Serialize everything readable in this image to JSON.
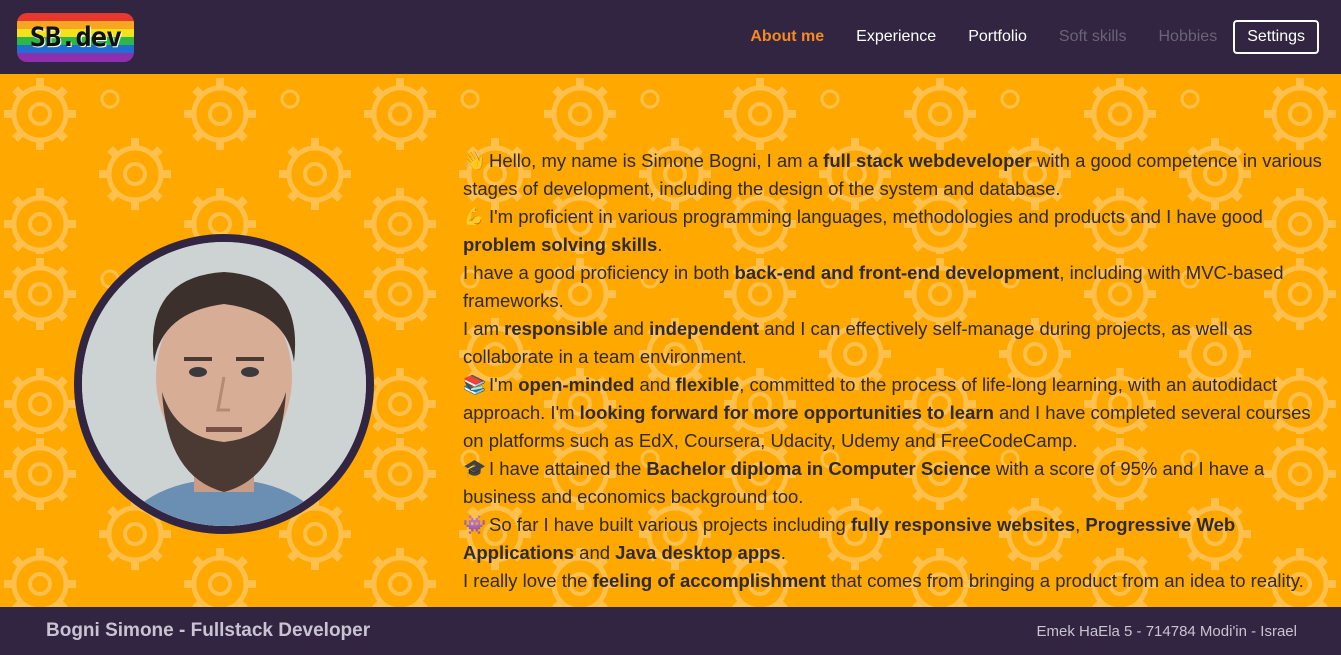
{
  "brand": {
    "logo_text": "SB.dev",
    "rainbow": [
      "#e8372d",
      "#f5a623",
      "#f5e11b",
      "#2db64a",
      "#1f6fd1",
      "#8e2fb0"
    ]
  },
  "nav": {
    "items": [
      {
        "label": "About me",
        "state": "active"
      },
      {
        "label": "Experience",
        "state": "normal"
      },
      {
        "label": "Portfolio",
        "state": "normal"
      },
      {
        "label": "Soft skills",
        "state": "disabled"
      },
      {
        "label": "Hobbies",
        "state": "disabled"
      }
    ],
    "settings_label": "Settings"
  },
  "about": {
    "paragraphs": [
      [
        {
          "emoji": "👋"
        },
        {
          "t": "Hello, my name is Simone Bogni, I am a "
        },
        {
          "b": "full stack webdeveloper"
        },
        {
          "t": " with a good competence in various stages of development, including the design of the system and database."
        }
      ],
      [
        {
          "emoji": "💪"
        },
        {
          "t": "I'm proficient in various programming languages, methodologies and products and I have good "
        },
        {
          "b": "problem solving skills"
        },
        {
          "t": "."
        }
      ],
      [
        {
          "t": "I have a good proficiency in both "
        },
        {
          "b": "back-end and front-end development"
        },
        {
          "t": ", including with MVC-based frameworks."
        }
      ],
      [
        {
          "t": "I am "
        },
        {
          "b": "responsible"
        },
        {
          "t": " and "
        },
        {
          "b": "independent"
        },
        {
          "t": " and I can effectively self-manage during projects, as well as collaborate in a team environment."
        }
      ],
      [
        {
          "emoji": "📚"
        },
        {
          "t": "I'm "
        },
        {
          "b": "open-minded"
        },
        {
          "t": " and "
        },
        {
          "b": "flexible"
        },
        {
          "t": ", committed to the process of life-long learning, with an autodidact approach. I'm "
        },
        {
          "b": "looking forward for more opportunities to learn"
        },
        {
          "t": " and I have completed several courses on platforms such as EdX, Coursera, Udacity, Udemy and FreeCodeCamp."
        }
      ],
      [
        {
          "emoji": "🎓"
        },
        {
          "t": "I have attained the "
        },
        {
          "b": "Bachelor diploma in Computer Science"
        },
        {
          "t": " with a score of 95% and I have a business and economics background too."
        }
      ],
      [
        {
          "emoji": "👾"
        },
        {
          "t": "So far I have built various projects including "
        },
        {
          "b": "fully responsive websites"
        },
        {
          "t": ", "
        },
        {
          "b": "Progressive Web Applications"
        },
        {
          "t": " and "
        },
        {
          "b": "Java desktop apps"
        },
        {
          "t": "."
        }
      ],
      [
        {
          "t": "I really love the "
        },
        {
          "b": "feeling of accomplishment"
        },
        {
          "t": " that comes from bringing a product from an idea to reality."
        }
      ]
    ]
  },
  "footer": {
    "name": "Bogni Simone - Fullstack Developer",
    "address": "Emek HaEla 5 - 714784 Modi'in - Israel"
  },
  "colors": {
    "navbar": "#312541",
    "background": "#ffa800",
    "accent": "#f48a22"
  },
  "icons": {
    "pattern": "gear-icon",
    "avatar": "profile-photo"
  }
}
